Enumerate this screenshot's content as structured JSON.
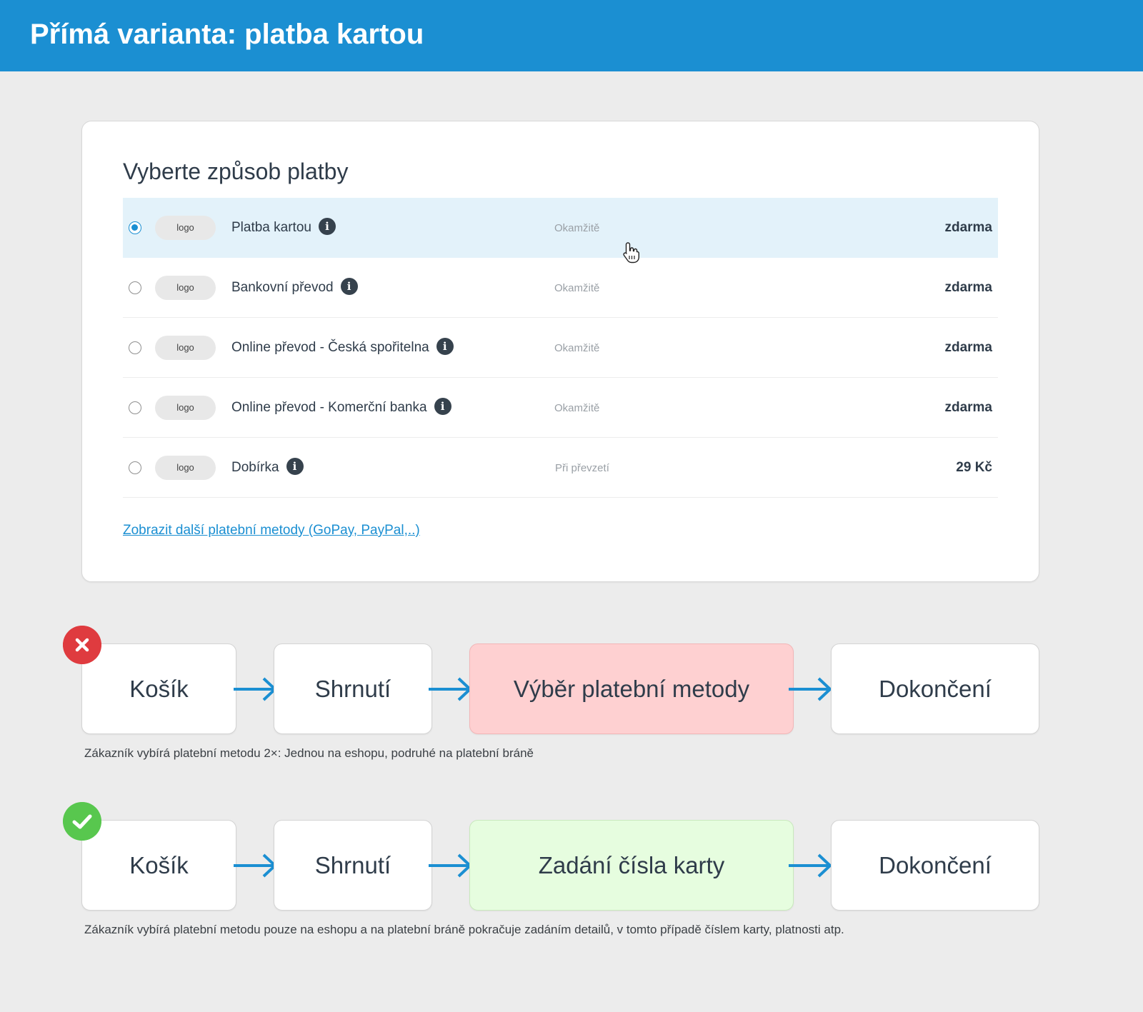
{
  "header": {
    "title": "Přímá varianta: platba kartou"
  },
  "colors": {
    "accent": "#1b8fd2",
    "bad": "#fed0d1",
    "good": "#e6fddf",
    "error_badge": "#df3b3f",
    "success_badge": "#58c74e"
  },
  "payment": {
    "title": "Vyberte způsob platby",
    "methods": [
      {
        "logo": "logo",
        "name": "Platba kartou",
        "timing": "Okamžitě",
        "price": "zdarma",
        "selected": true
      },
      {
        "logo": "logo",
        "name": "Bankovní převod",
        "timing": "Okamžitě",
        "price": "zdarma",
        "selected": false
      },
      {
        "logo": "logo",
        "name": "Online převod - Česká spořitelna",
        "timing": "Okamžitě",
        "price": "zdarma",
        "selected": false
      },
      {
        "logo": "logo",
        "name": "Online převod - Komerční banka",
        "timing": "Okamžitě",
        "price": "zdarma",
        "selected": false
      },
      {
        "logo": "logo",
        "name": "Dobírka",
        "timing": "Při převzetí",
        "price": "29 Kč",
        "selected": false
      }
    ],
    "more_link": "Zobrazit další platební metody (GoPay, PayPal,..)"
  },
  "flows": [
    {
      "status": "bad",
      "badge_icon": "x-icon",
      "steps": [
        "Košík",
        "Shrnutí",
        "Výběr platební metody",
        "Dokončení"
      ],
      "caption": "Zákazník vybírá platební metodu 2×: Jednou na eshopu, podruhé na platební bráně"
    },
    {
      "status": "good",
      "badge_icon": "checkmark-icon",
      "steps": [
        "Košík",
        "Shrnutí",
        "Zadání čísla karty",
        "Dokončení"
      ],
      "caption": "Zákazník vybírá platební metodu pouze na eshopu a na platební bráně pokračuje zadáním detailů, v tomto případě číslem karty, platnosti atp."
    }
  ]
}
